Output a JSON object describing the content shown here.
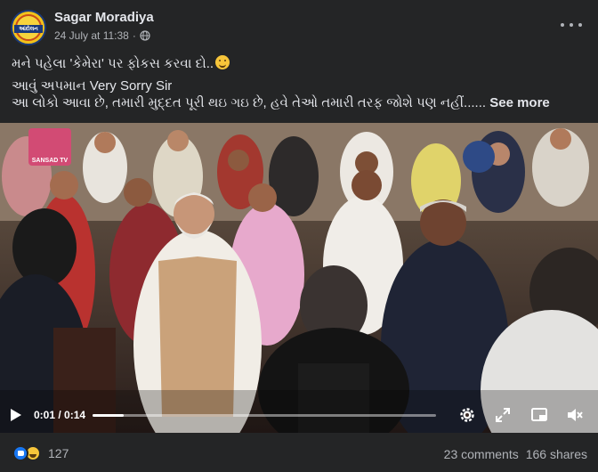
{
  "post": {
    "author": "Sagar Moradiya",
    "timestamp": "24 July at 11:38",
    "separator": "·",
    "privacy_icon": "globe-icon",
    "more_icon": "more-horizontal-icon",
    "avatar_text": "આંદોલન",
    "text": {
      "line1": "મને પહેલા 'કેમેરા' પર ફોકસ કરવા દો..",
      "line1_emoji": "smiling-face-icon",
      "line2": "આવું અપમાન Very Sorry Sir",
      "line3": "આ લોકો આવા છે, તમારી મુદ્દત પૂરી થઇ ગઇ છે, હવે તેઓ તમારી તરફ જોશે પણ નહીં...... ",
      "see_more": "See more"
    }
  },
  "video": {
    "watermark": "SANSAD TV",
    "current_time": "0:01",
    "duration": "0:14",
    "time_separator": " / ",
    "progress": 0.09,
    "controls": [
      "play-icon",
      "settings-gear-icon",
      "fullscreen-expand-icon",
      "picture-in-picture-icon",
      "volume-muted-icon"
    ]
  },
  "footer": {
    "reactions": [
      "like-icon",
      "haha-icon"
    ],
    "reaction_count": "127",
    "comments": "23 comments",
    "shares": "166 shares"
  },
  "colors": {
    "background": "#242526",
    "text_primary": "#e4e6eb",
    "text_secondary": "#b0b3b8",
    "like_blue": "#1877f2"
  }
}
